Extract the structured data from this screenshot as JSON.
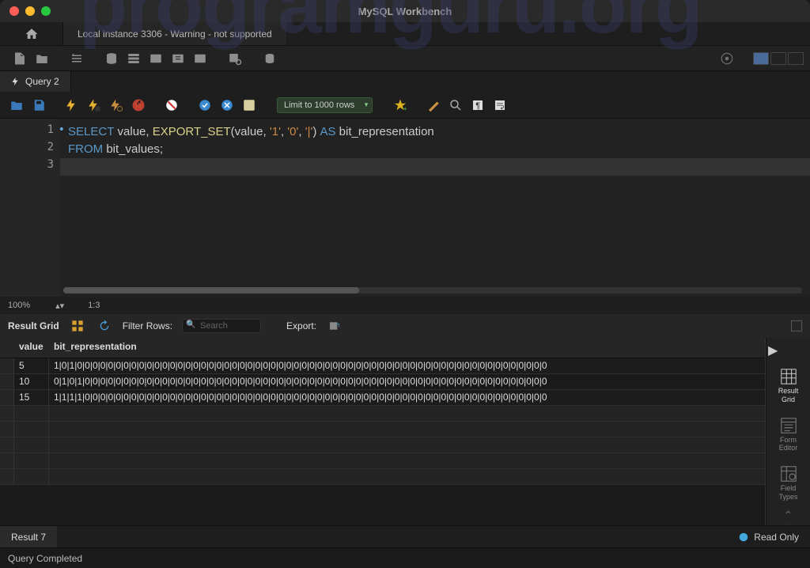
{
  "title": "MySQL Workbench",
  "connection_tab": "Local instance 3306 - Warning - not supported",
  "query_tab": "Query 2",
  "row_limit": "Limit to 1000 rows",
  "zoom": "100%",
  "cursor_pos": "1:3",
  "sql": {
    "line1_a": "SELECT",
    "line1_b": " value, ",
    "line1_c": "EXPORT_SET",
    "line1_d": "(value, ",
    "line1_e": "'1'",
    "line1_f": ", ",
    "line1_g": "'0'",
    "line1_h": ", ",
    "line1_i": "'|'",
    "line1_j": ") ",
    "line1_k": "AS",
    "line1_l": " bit_representation",
    "line2_a": "FROM",
    "line2_b": " bit_values;"
  },
  "line_numbers": [
    "1",
    "2",
    "3"
  ],
  "result_grid_label": "Result Grid",
  "filter_rows_label": "Filter Rows:",
  "search_placeholder": "Search",
  "export_label": "Export:",
  "columns": [
    "value",
    "bit_representation"
  ],
  "rows": [
    {
      "value": "5",
      "rep": "1|0|1|0|0|0|0|0|0|0|0|0|0|0|0|0|0|0|0|0|0|0|0|0|0|0|0|0|0|0|0|0|0|0|0|0|0|0|0|0|0|0|0|0|0|0|0|0|0|0|0|0|0|0|0|0|0|0|0|0|0|0|0|0"
    },
    {
      "value": "10",
      "rep": "0|1|0|1|0|0|0|0|0|0|0|0|0|0|0|0|0|0|0|0|0|0|0|0|0|0|0|0|0|0|0|0|0|0|0|0|0|0|0|0|0|0|0|0|0|0|0|0|0|0|0|0|0|0|0|0|0|0|0|0|0|0|0|0"
    },
    {
      "value": "15",
      "rep": "1|1|1|1|0|0|0|0|0|0|0|0|0|0|0|0|0|0|0|0|0|0|0|0|0|0|0|0|0|0|0|0|0|0|0|0|0|0|0|0|0|0|0|0|0|0|0|0|0|0|0|0|0|0|0|0|0|0|0|0|0|0|0|0"
    }
  ],
  "side_labels": {
    "result_grid": "Result\nGrid",
    "form_editor": "Form\nEditor",
    "field_types": "Field\nTypes"
  },
  "result_tab": "Result 7",
  "read_only": "Read Only",
  "footer": "Query Completed",
  "watermark": "programguru.org"
}
